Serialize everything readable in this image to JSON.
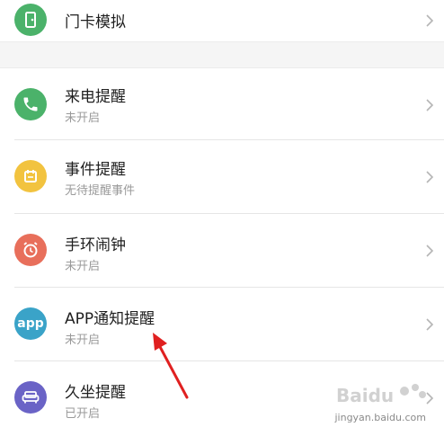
{
  "top_item": {
    "title": "门卡模拟",
    "icon": "door-card-icon",
    "color": "#4bb26a"
  },
  "items": [
    {
      "title": "来电提醒",
      "subtitle": "未开启",
      "icon": "phone-icon",
      "color": "#4bb26a"
    },
    {
      "title": "事件提醒",
      "subtitle": "无待提醒事件",
      "icon": "calendar-icon",
      "color": "#f2c33f"
    },
    {
      "title": "手环闹钟",
      "subtitle": "未开启",
      "icon": "alarm-clock-icon",
      "color": "#e86f5b"
    },
    {
      "title": "APP通知提醒",
      "subtitle": "未开启",
      "icon": "app-icon",
      "color": "#3aa3c8"
    },
    {
      "title": "久坐提醒",
      "subtitle": "已开启",
      "icon": "sofa-icon",
      "color": "#6a63c6"
    }
  ],
  "app_icon_text": "app",
  "annotation_arrow": "red-arrow-icon",
  "watermark": {
    "brand": "Baidu",
    "text": "jingyan.baidu.com"
  }
}
